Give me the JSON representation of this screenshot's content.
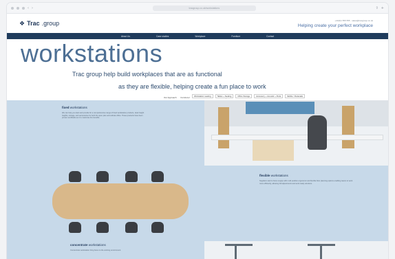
{
  "browser": {
    "url": "tracgroup.co.uk/workstations"
  },
  "header": {
    "logo_bold": "Trac",
    "logo_rest": ".group",
    "contact": "+44(0)1 555 555 · sales@tracgroup.co.uk",
    "tagline": "Helping create your perfect workplace"
  },
  "nav": [
    "About Us",
    "Case studies",
    "Workplace",
    "Furniture",
    "Contact"
  ],
  "hero": {
    "title": "workstations",
    "line1": "Trac group help build workplaces that are as functional",
    "line2": "as they are flexible, helping create a fun place to work"
  },
  "tabs": [
    "Our Approach",
    "Furniture Partners",
    "Workstations",
    "Shared spaces"
  ],
  "subtabs": [
    "Workstation seating",
    "Tables + Seating",
    "Office Storage",
    "Accessory + Acoustic + Pods",
    "Mobile / Pedestals"
  ],
  "sections": {
    "fixed": {
      "title_bold": "fixed",
      "title_rest": "workstations",
      "text": "We can help you start and provide for a comprehensive range of fixed workstation products, desk height heights, storage, and accessories for both the open plan and cellular office. These products have been proven worldwide as it to maximise the benefits."
    },
    "flexible": {
      "title_bold": "flexible",
      "title_rest": "workstations",
      "text": "Suppliers start to focus supply with multi position ergonomic and flexible floor planning options enabling teams to work more efficiently, allowing full adjustments and work ready solutions."
    },
    "concentrate": {
      "title_bold": "concentrate",
      "title_rest": "workstations",
      "text": "Concentrate workstation bring focus to the working environment."
    }
  }
}
